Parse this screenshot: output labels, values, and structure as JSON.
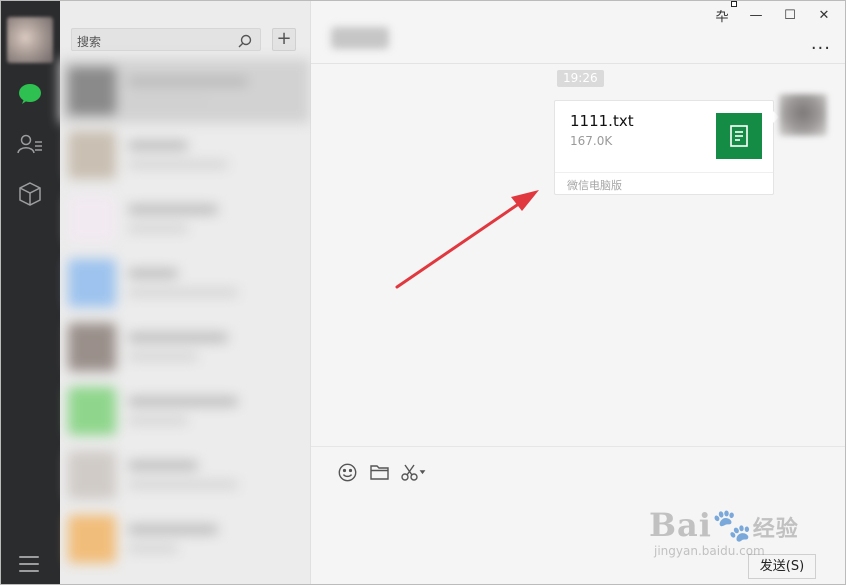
{
  "sidebar": {
    "icons": [
      "chat-bubble-icon",
      "contacts-icon",
      "box-icon",
      "menu-icon"
    ],
    "accent": "#2ec050"
  },
  "search": {
    "placeholder": "搜索",
    "add_label": "+"
  },
  "chat": {
    "time": "19:26",
    "file": {
      "name": "1111.txt",
      "size": "167.0K",
      "source": "微信电脑版",
      "icon_color": "#148c46"
    },
    "more_label": "..."
  },
  "window": {
    "pin": "卆",
    "minimize": "—",
    "maximize": "☐",
    "close": "✕"
  },
  "compose": {
    "send_label": "发送(S)"
  },
  "watermark": {
    "brand": "Bai",
    "brand2": "经验",
    "url": "jingyan.baidu.com"
  }
}
